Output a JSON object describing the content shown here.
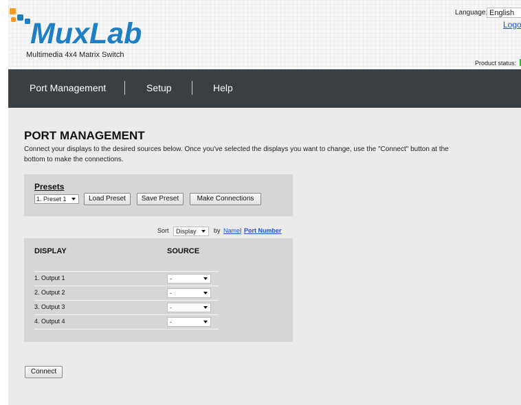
{
  "header": {
    "brand": "MuxLab",
    "subtitle": "Multimedia 4x4 Matrix Switch",
    "language_label": "Language:",
    "language_value": "English",
    "logout_label": "Logo",
    "product_status_label": "Product status:",
    "status_color": "#25c225"
  },
  "nav": {
    "items": [
      {
        "label": "Port Management"
      },
      {
        "label": "Setup"
      },
      {
        "label": "Help"
      }
    ]
  },
  "main": {
    "title": "PORT MANAGEMENT",
    "description": "Connect your displays to the desired sources below. Once you've selected the displays you want to change, use the \"Connect\" button at the bottom to make the connections.",
    "presets": {
      "label": "Presets",
      "selected": "1. Preset 1",
      "load_label": "Load Preset",
      "save_label": "Save Preset",
      "make_label": "Make Connections"
    },
    "sort": {
      "label": "Sort",
      "selected": "Display",
      "by_label": "by",
      "name_link": "Name",
      "separator": "|",
      "port_number_link": "Port Number"
    },
    "table": {
      "display_header": "DISPLAY",
      "source_header": "SOURCE",
      "rows": [
        {
          "display": "1. Output 1",
          "source": "-"
        },
        {
          "display": "2. Output 2",
          "source": "-"
        },
        {
          "display": "3. Output 3",
          "source": "-"
        },
        {
          "display": "4. Output 4",
          "source": "-"
        }
      ]
    },
    "connect_label": "Connect"
  }
}
